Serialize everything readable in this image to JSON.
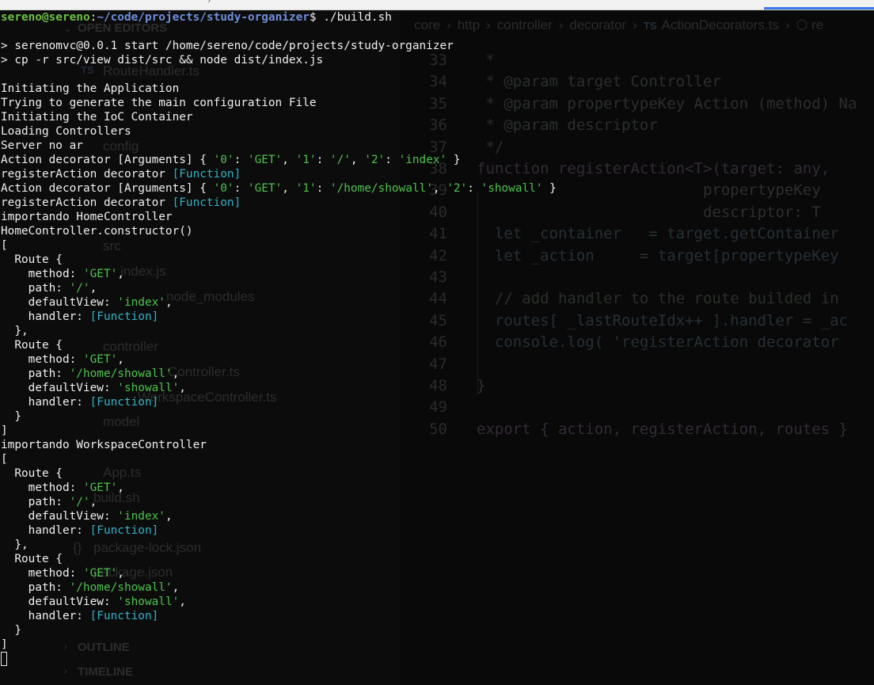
{
  "terminal": {
    "prompt_user": "sereno@sereno",
    "prompt_sep": ":",
    "prompt_path": "~/code/projects/study-organizer",
    "prompt_symbol": "$",
    "command": "./build.sh",
    "npm_line": "> serenomvc@0.0.1 start /home/sereno/code/projects/study-organizer",
    "npm_cmd": "> cp -r src/view dist/src && node dist/index.js",
    "log_init_app": "Initiating the Application",
    "log_gen_config": "Trying to generate the main configuration File",
    "log_ioc": "Initiating the IoC Container",
    "log_loading": "Loading Controllers",
    "log_server": "Server no ar",
    "decorator_prefix": "Action decorator [Arguments] { ",
    "key0": "'0'",
    "key1": "'1'",
    "key2": "'2'",
    "colon": ": ",
    "comma": ", ",
    "close_brace": " }",
    "get": "'GET'",
    "slash": "'/'",
    "index": "'index'",
    "showall_path": "'/home/showall'",
    "showall": "'showall'",
    "register_prefix": "registerAction decorator ",
    "function": "[Function]",
    "import_home": "importando HomeController",
    "home_ctor": "HomeController.constructor()",
    "import_workspace": "importando WorkspaceController",
    "open_bracket": "[",
    "close_bracket": "]",
    "route_open": "  Route {",
    "method_label": "    method: ",
    "path_label": "    path: ",
    "view_label": "    defaultView: ",
    "handler_label": "    handler: ",
    "route_close_comma": "  },",
    "route_close": "  }",
    "trailing_comma": ","
  },
  "background_editor": {
    "breadcrumb": [
      "core",
      "http",
      "controller",
      "decorator",
      "ActionDecorators.ts",
      "re"
    ],
    "breadcrumb_ts_badge": "TS",
    "sidebar": {
      "open_editors": "OPEN EDITORS",
      "route_handler": "RouteHandler.ts",
      "config": "config",
      "src": "src",
      "index_js": "index.js",
      "node_modules": "node_modules",
      "controller": "controller",
      "home_controller": "Controller.ts",
      "workspace_controller": "WorkspaceController.ts",
      "model": "model",
      "app_ts": "App.ts",
      "build_sh": "build.sh",
      "package_lock": "package-lock.json",
      "package_json": "package.json",
      "outline": "OUTLINE",
      "timeline": "TIMELINE"
    },
    "lines": [
      {
        "n": "33",
        "text": " *"
      },
      {
        "n": "34",
        "text": " * @param target Controller"
      },
      {
        "n": "35",
        "text": " * @param propertypeKey Action (method) Na"
      },
      {
        "n": "36",
        "text": " * @param descriptor"
      },
      {
        "n": "37",
        "text": " */"
      },
      {
        "n": "38",
        "text": "function registerAction<T>(target: any,"
      },
      {
        "n": "39",
        "text": "                         propertypeKey"
      },
      {
        "n": "40",
        "text": "                         descriptor: T"
      },
      {
        "n": "41",
        "text": "  let _container   = target.getContainer"
      },
      {
        "n": "42",
        "text": "  let _action     = target[propertypeKey"
      },
      {
        "n": "43",
        "text": ""
      },
      {
        "n": "44",
        "text": "  // add handler to the route builded in"
      },
      {
        "n": "45",
        "text": "  routes[ _lastRouteIdx++ ].handler = _ac"
      },
      {
        "n": "46",
        "text": "  console.log( 'registerAction decorator"
      },
      {
        "n": "47",
        "text": ""
      },
      {
        "n": "48",
        "text": "}"
      },
      {
        "n": "49",
        "text": ""
      },
      {
        "n": "50",
        "text": "export { action, registerAction, routes }"
      }
    ]
  },
  "colors": {
    "terminal_bg": "#0b0b0b",
    "prompt_user": "#6ec047",
    "prompt_path": "#6f8fdc",
    "string": "#4ec24e",
    "function": "#34b1c4"
  }
}
